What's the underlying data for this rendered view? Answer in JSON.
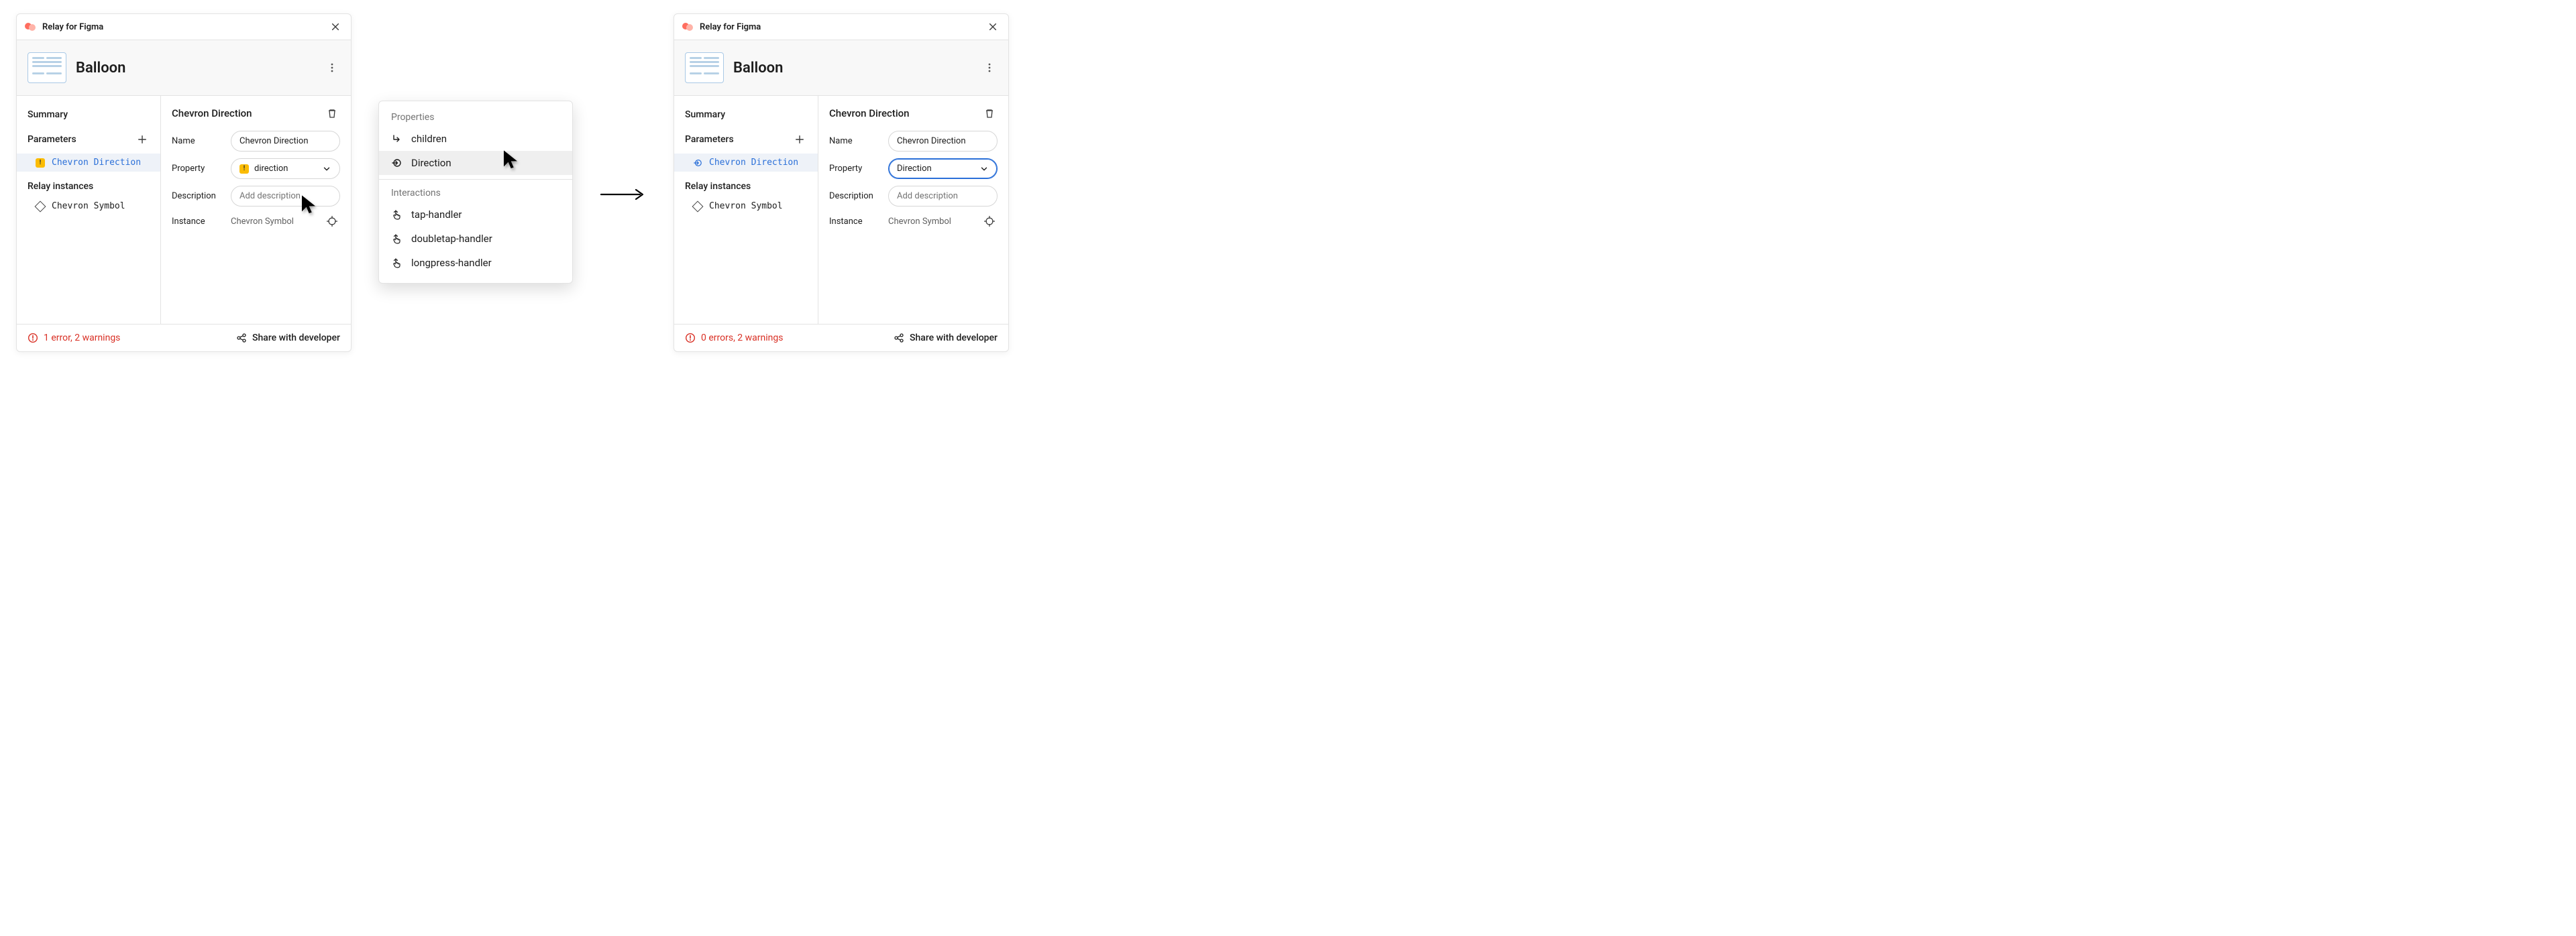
{
  "app": {
    "title": "Relay for Figma"
  },
  "component": {
    "name": "Balloon"
  },
  "sidebar": {
    "summary_label": "Summary",
    "parameters_label": "Parameters",
    "instances_label": "Relay instances",
    "selected_param": "Chevron Direction",
    "instance_item": "Chevron Symbol"
  },
  "content": {
    "title": "Chevron Direction",
    "labels": {
      "name": "Name",
      "property": "Property",
      "description": "Description",
      "instance": "Instance"
    },
    "name_value": "Chevron Direction",
    "property_value_before": "direction",
    "property_value_after": "Direction",
    "description_placeholder": "Add description",
    "instance_value": "Chevron Symbol"
  },
  "popup": {
    "properties_label": "Properties",
    "interactions_label": "Interactions",
    "options": {
      "children": "children",
      "direction": "Direction",
      "tap": "tap-handler",
      "doubletap": "doubletap-handler",
      "longpress": "longpress-handler"
    }
  },
  "footer": {
    "status_before": "1 error, 2 warnings",
    "status_after": "0 errors, 2 warnings",
    "share_label": "Share with developer"
  }
}
